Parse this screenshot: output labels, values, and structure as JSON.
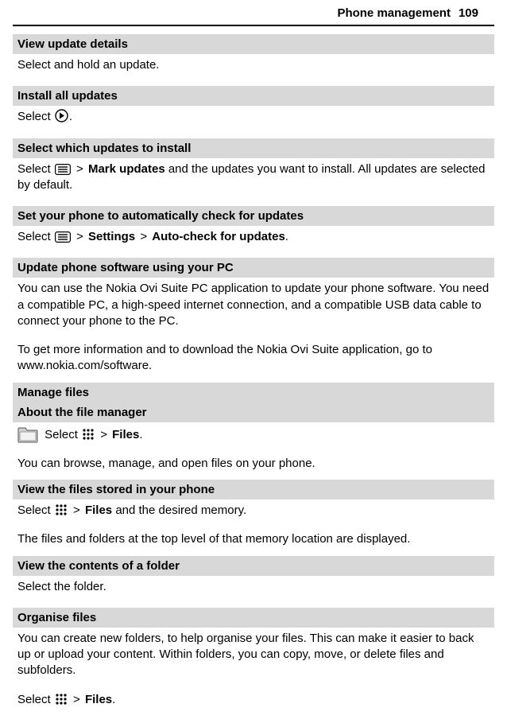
{
  "header": {
    "title": "Phone management",
    "page": "109"
  },
  "sections": {
    "view_update_details": {
      "title": "View update details",
      "body": "Select and hold an update."
    },
    "install_all": {
      "title": "Install all updates",
      "pre": "Select ",
      "post": "."
    },
    "select_which": {
      "title": "Select which updates to install",
      "pre": "Select ",
      "gt": ">",
      "mark": "Mark updates",
      "post": " and the updates you want to install. All updates are selected by default."
    },
    "auto_check": {
      "title": "Set your phone to automatically check for updates",
      "pre": "Select ",
      "gt1": ">",
      "settings": "Settings",
      "gt2": ">",
      "autocheck": "Auto-check for updates",
      "post": "."
    },
    "update_pc": {
      "title": "Update phone software using your PC",
      "body1": "You can use the Nokia Ovi Suite PC application to update your phone software. You need a compatible PC, a high-speed internet connection, and a compatible USB data cable to connect your phone to the PC.",
      "body2": "To get more information and to download the Nokia Ovi Suite application, go to www.nokia.com/software."
    },
    "manage_files": {
      "title": "Manage files"
    },
    "about_fm": {
      "title": "About the file manager",
      "pre": " Select ",
      "gt": ">",
      "files": "Files",
      "post": ".",
      "body2": "You can browse, manage, and open files on your phone."
    },
    "view_files": {
      "title": "View the files stored in your phone",
      "pre": "Select ",
      "gt": ">",
      "files": "Files",
      "post": " and the desired memory.",
      "body2": "The files and folders at the top level of that memory location are displayed."
    },
    "view_folder": {
      "title": "View the contents of a folder",
      "body": "Select the folder."
    },
    "organise": {
      "title": "Organise files",
      "body1": "You can create new folders, to help organise your files. This can make it easier to back up or upload your content. Within folders, you can copy, move, or delete files and subfolders.",
      "pre": "Select ",
      "gt": ">",
      "files": "Files",
      "post": "."
    }
  }
}
